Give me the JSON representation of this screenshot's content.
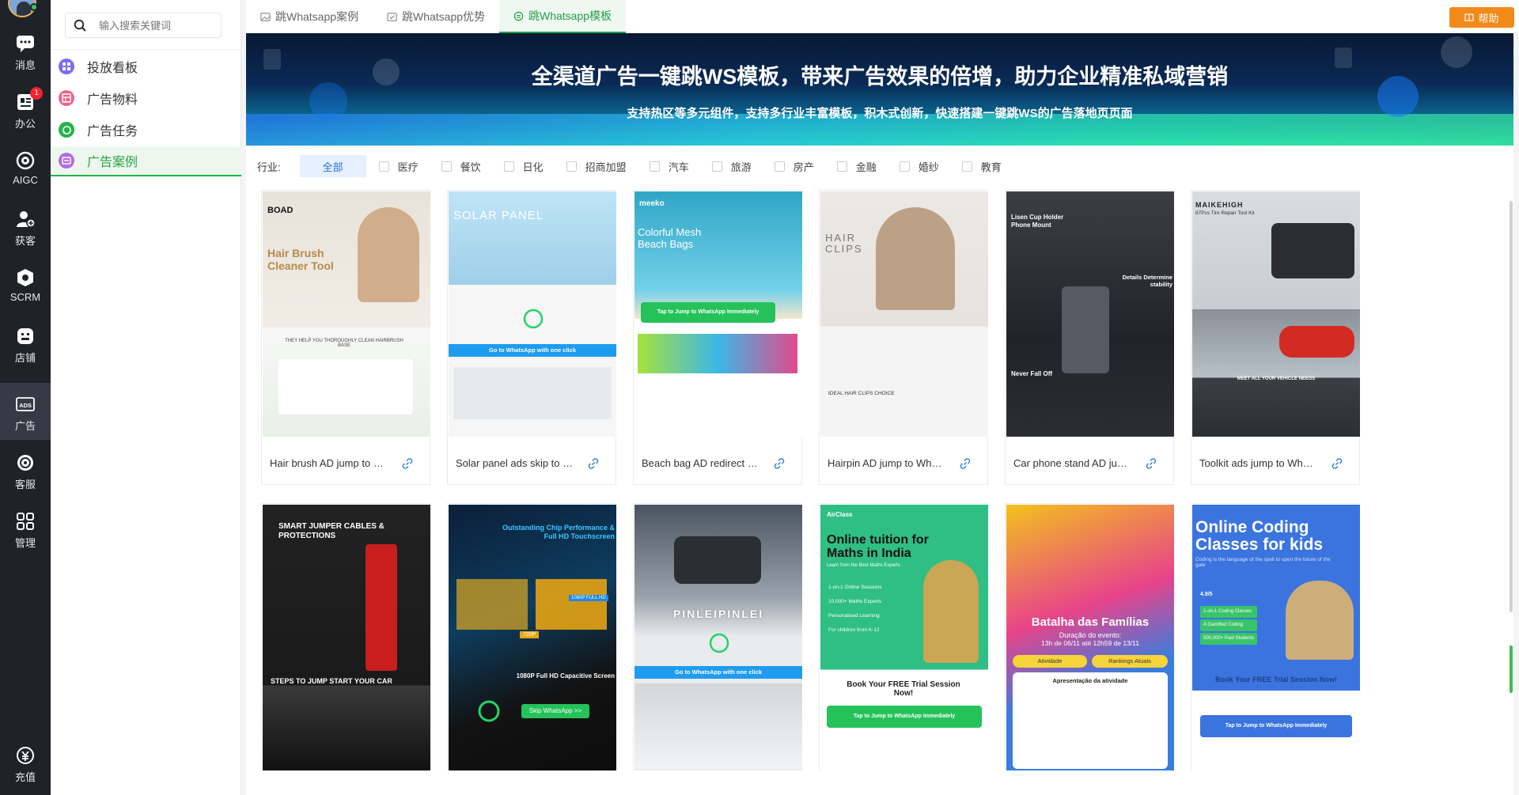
{
  "rail": {
    "items": [
      {
        "label": "消息",
        "icon": "message-icon"
      },
      {
        "label": "办公",
        "icon": "office-icon",
        "badge": "1"
      },
      {
        "label": "AIGC",
        "icon": "aigc-icon"
      },
      {
        "label": "获客",
        "icon": "customer-acquire-icon"
      },
      {
        "label": "SCRM",
        "icon": "scrm-icon"
      },
      {
        "label": "店铺",
        "icon": "store-icon"
      },
      {
        "label": "广告",
        "icon": "ads-icon"
      },
      {
        "label": "客服",
        "icon": "customer-service-icon"
      },
      {
        "label": "管理",
        "icon": "grid-icon"
      },
      {
        "label": "充值",
        "icon": "recharge-icon"
      }
    ]
  },
  "sub": {
    "search_placeholder": "输入搜索关键词",
    "items": [
      {
        "label": "投放看板",
        "color": "#7b6df2"
      },
      {
        "label": "广告物料",
        "color": "#f0648c"
      },
      {
        "label": "广告任务",
        "color": "#25b34a"
      },
      {
        "label": "广告案例",
        "color": "#b26ae8"
      }
    ]
  },
  "tabs": [
    {
      "label": "跳Whatsapp案例"
    },
    {
      "label": "跳Whatsapp优势"
    },
    {
      "label": "跳Whatsapp模板"
    }
  ],
  "help_label": "帮助",
  "banner": {
    "title": "全渠道广告一键跳WS模板，带来广告效果的倍增，助力企业精准私域营销",
    "subtitle": "支持热区等多元组件，支持多行业丰富模板，积木式创新，快速搭建一键跳WS的广告落地页页面"
  },
  "filter": {
    "label": "行业:",
    "all": "全部",
    "options": [
      "医疗",
      "餐饮",
      "日化",
      "招商加盟",
      "汽车",
      "旅游",
      "房产",
      "金融",
      "婚纱",
      "教育"
    ]
  },
  "cards_row1": [
    {
      "title": "Hair brush AD jump to WhatsApp",
      "brand": "BOAD",
      "headline": "Hair Brush Cleaner Tool",
      "sub": "THEY HELP YOU THOROUGHLY CLEAN HAIRBRUSH BASE"
    },
    {
      "title": "Solar panel ads skip to WhatsApp",
      "headline": "SOLAR PANEL",
      "cta": "Go to WhatsApp with one click"
    },
    {
      "title": "Beach bag AD redirect to WhatsApp",
      "brand": "meeko",
      "headline": "Colorful Mesh Beach Bags",
      "cta": "Tap to Jump to WhatsApp Immediately"
    },
    {
      "title": "Hairpin AD jump to WhatsApp",
      "headline": "HAIR CLIPS",
      "sub": "IDEAL HAIR CLIPS CHOICE"
    },
    {
      "title": "Car phone stand AD jump to WhatsApp",
      "headline": "Lisen Cup Holder Phone Mount",
      "sub": "Details Determine stability",
      "sub2": "Never Fall Off"
    },
    {
      "title": "Toolkit ads jump to WhatsApp",
      "brand": "MAIKEHIGH",
      "headline": "87Pcs Tire Repair Tool Kit",
      "sub": "MEET ALL YOUR VEHICLE NEEDS"
    }
  ],
  "cards_row2": [
    {
      "headline": "SMART JUMPER CABLES & PROTECTIONS",
      "sub": "STEPS TO JUMP START YOUR CAR"
    },
    {
      "headline": "Outstanding Chip Performance & Full HD Touchscreen",
      "sub": "1080P Full HD Capacitive Screen",
      "badge1": "720P",
      "badge2": "1080P FULL HD",
      "cta": "Skip WhatsApp >>"
    },
    {
      "headline": "PINLEIPINLEI",
      "cta": "Go to WhatsApp with one click"
    },
    {
      "brand": "AirClass",
      "headline": "Online tuition for Maths in India",
      "sub": "Learn from the Best Maths Experts",
      "list": [
        "1-on-1 Online Sessions",
        "10,000+ Maths Experts",
        "Personalised Learning",
        "For children from K-12"
      ],
      "offer": "Book Your FREE Trial Session Now!",
      "cta": "Tap to Jump to WhatsApp Immediately"
    },
    {
      "headline": "Batalha das Famílias",
      "sub": "Duração do evento:",
      "sub2": "13h de 06/11 até 12h59 de 13/11",
      "btn1": "Atividade",
      "btn2": "Rankings Atuais",
      "section": "Apresentação da atividade"
    },
    {
      "headline": "Online Coding Classes for kids",
      "sub": "Coding is the language of the spell to open the future of the gate",
      "rating": "4.9/5",
      "list": [
        "1-on-1 Coding Classes",
        "A Gamified Coding",
        "500,000+ Paid Students"
      ],
      "offer": "Book Your FREE Trial Session Now!",
      "cta": "Tap to Jump to WhatsApp Immediately"
    }
  ]
}
